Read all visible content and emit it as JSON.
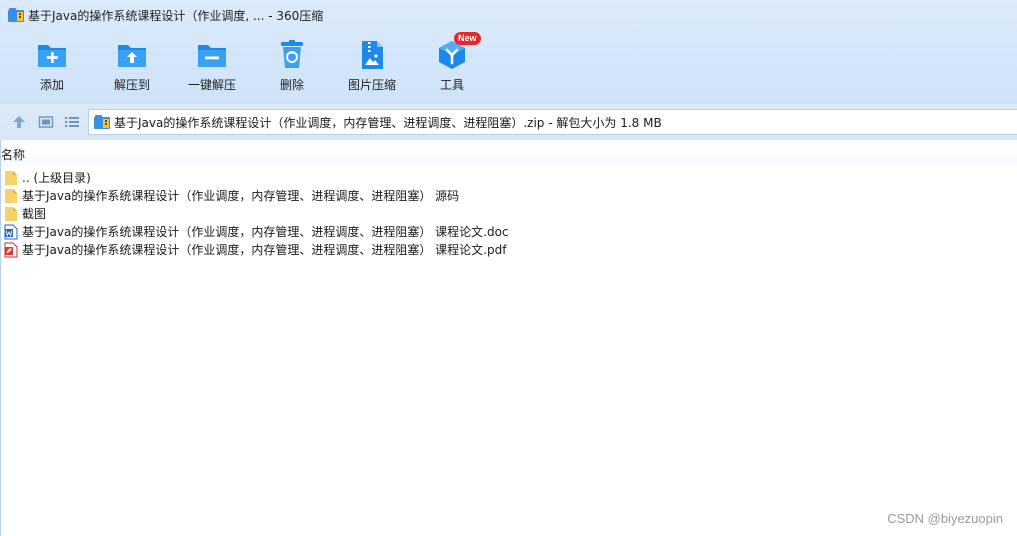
{
  "window": {
    "title": "基于Java的操作系统课程设计（作业调度, ... - 360压缩"
  },
  "toolbar": {
    "items": [
      {
        "label": "添加",
        "icon": "add-folder-icon"
      },
      {
        "label": "解压到",
        "icon": "extract-to-icon"
      },
      {
        "label": "一键解压",
        "icon": "one-click-extract-icon"
      },
      {
        "label": "删除",
        "icon": "delete-bin-icon"
      },
      {
        "label": "图片压缩",
        "icon": "image-compress-icon"
      },
      {
        "label": "工具",
        "icon": "tools-cube-icon",
        "badge": "New"
      }
    ]
  },
  "navigation": {
    "up_icon": "up-arrow-icon",
    "thumb_view_icon": "thumbnail-view-icon",
    "list_view_icon": "list-view-icon",
    "address": "基于Java的操作系统课程设计（作业调度，内存管理、进程调度、进程阻塞）.zip - 解包大小为 1.8 MB"
  },
  "list": {
    "column_name": "名称",
    "files": [
      {
        "name": ".. (上级目录)",
        "type": "folder"
      },
      {
        "name": "基于Java的操作系统课程设计（作业调度，内存管理、进程调度、进程阻塞） 源码",
        "type": "folder"
      },
      {
        "name": "截图",
        "type": "folder"
      },
      {
        "name": "基于Java的操作系统课程设计（作业调度，内存管理、进程调度、进程阻塞） 课程论文.doc",
        "type": "doc"
      },
      {
        "name": "基于Java的操作系统课程设计（作业调度，内存管理、进程调度、进程阻塞） 课程论文.pdf",
        "type": "pdf"
      }
    ]
  },
  "watermark": "CSDN @biyezuopin",
  "colors": {
    "accent": "#1e8ae8",
    "header_bg": "#d6e8fa",
    "badge": "#e8272a",
    "folder": "#f5d36b"
  }
}
